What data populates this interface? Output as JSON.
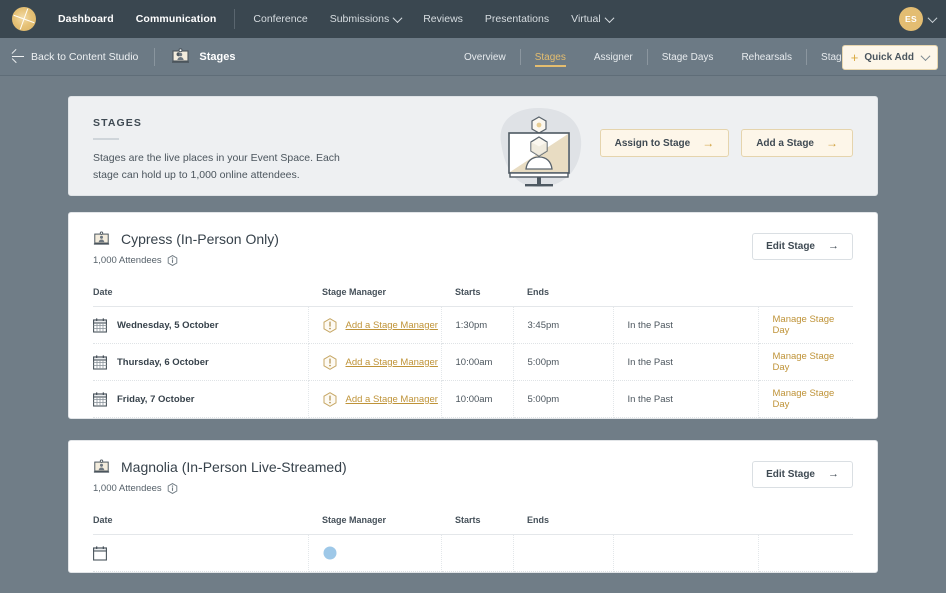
{
  "topnav": {
    "logo": "sunburst-logo",
    "primary": [
      {
        "label": "Dashboard"
      },
      {
        "label": "Communication"
      }
    ],
    "secondary": [
      {
        "label": "Conference",
        "caret": false
      },
      {
        "label": "Submissions",
        "caret": true
      },
      {
        "label": "Reviews",
        "caret": false
      },
      {
        "label": "Presentations",
        "caret": false
      },
      {
        "label": "Virtual",
        "caret": true
      }
    ],
    "avatar_initials": "ES"
  },
  "subnav": {
    "back_label": "Back to Content Studio",
    "title": "Stages",
    "tabs": [
      {
        "label": "Overview",
        "active": false
      },
      {
        "label": "Stages",
        "active": true
      },
      {
        "label": "Assigner",
        "active": false
      },
      {
        "label": "Stage Days",
        "active": false
      },
      {
        "label": "Rehearsals",
        "active": false
      },
      {
        "label": "Stage Managers",
        "active": false
      }
    ],
    "quick_add": "Quick Add"
  },
  "hero": {
    "title": "STAGES",
    "description": "Stages are the live places in your Event Space. Each stage can hold up to 1,000 online attendees.",
    "assign_button": "Assign to Stage",
    "add_button": "Add a Stage"
  },
  "table_headers": {
    "date": "Date",
    "stage_manager": "Stage Manager",
    "starts": "Starts",
    "ends": "Ends"
  },
  "stages": [
    {
      "name": "Cypress (In-Person Only)",
      "attendees": "1,000 Attendees",
      "edit_button": "Edit Stage",
      "rows": [
        {
          "date": "Wednesday, 5 October",
          "stage_manager": "Add a Stage Manager",
          "starts": "1:30pm",
          "ends": "3:45pm",
          "status": "In the Past",
          "action": "Manage Stage Day"
        },
        {
          "date": "Thursday, 6 October",
          "stage_manager": "Add a Stage Manager",
          "starts": "10:00am",
          "ends": "5:00pm",
          "status": "In the Past",
          "action": "Manage Stage Day"
        },
        {
          "date": "Friday, 7 October",
          "stage_manager": "Add a Stage Manager",
          "starts": "10:00am",
          "ends": "5:00pm",
          "status": "In the Past",
          "action": "Manage Stage Day"
        }
      ]
    },
    {
      "name": "Magnolia (In-Person Live-Streamed)",
      "attendees": "1,000 Attendees",
      "edit_button": "Edit Stage",
      "rows": []
    }
  ],
  "colors": {
    "topnav_bg": "#3a4750",
    "subnav_bg": "#6c7a85",
    "page_bg": "#707d87",
    "accent_gold": "#bf9338",
    "accent_gold_light": "#e4bd6f",
    "card_bg": "#eef0f2",
    "white": "#ffffff",
    "text_dark": "#37424b"
  }
}
